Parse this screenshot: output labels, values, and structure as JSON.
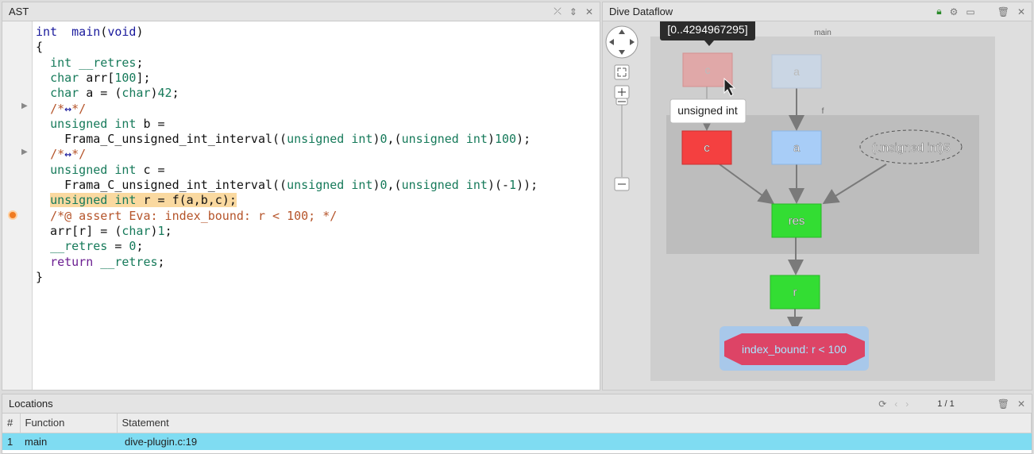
{
  "ast": {
    "title": "AST",
    "lines": [
      {
        "tokens": [
          [
            "kw",
            "int"
          ],
          [
            "",
            "  "
          ],
          [
            "kw",
            "main"
          ],
          [
            "",
            "("
          ],
          [
            "kw",
            "void"
          ],
          [
            "",
            ")"
          ]
        ]
      },
      {
        "tokens": [
          [
            "",
            "{"
          ]
        ]
      },
      {
        "tokens": [
          [
            "",
            "  "
          ],
          [
            "ty",
            "int"
          ],
          [
            "",
            " "
          ],
          [
            "ty",
            "__retres"
          ],
          [
            "",
            ";"
          ]
        ]
      },
      {
        "tokens": [
          [
            "",
            "  "
          ],
          [
            "ty",
            "char"
          ],
          [
            "",
            " arr["
          ],
          [
            "num",
            "100"
          ],
          [
            "",
            "];"
          ]
        ]
      },
      {
        "tokens": [
          [
            "",
            "  "
          ],
          [
            "ty",
            "char"
          ],
          [
            "",
            " a = ("
          ],
          [
            "ty",
            "char"
          ],
          [
            "",
            ")"
          ],
          [
            "num",
            "42"
          ],
          [
            "",
            ";"
          ]
        ]
      },
      {
        "tokens": [
          [
            "",
            "  "
          ],
          [
            "cm",
            "/*"
          ],
          [
            "kw",
            "↔"
          ],
          [
            "cm",
            "*/"
          ]
        ]
      },
      {
        "tokens": [
          [
            "",
            "  "
          ],
          [
            "ty",
            "unsigned int"
          ],
          [
            "",
            " b ="
          ]
        ]
      },
      {
        "tokens": [
          [
            "",
            "    Frama_C_unsigned_int_interval(("
          ],
          [
            "ty",
            "unsigned int"
          ],
          [
            "",
            ")"
          ],
          [
            "num",
            "0"
          ],
          [
            "",
            ",("
          ],
          [
            "ty",
            "unsigned int"
          ],
          [
            "",
            ")"
          ],
          [
            "num",
            "100"
          ],
          [
            "",
            ");"
          ]
        ]
      },
      {
        "tokens": [
          [
            "",
            "  "
          ],
          [
            "cm",
            "/*"
          ],
          [
            "kw",
            "↔"
          ],
          [
            "cm",
            "*/"
          ]
        ]
      },
      {
        "tokens": [
          [
            "",
            "  "
          ],
          [
            "ty",
            "unsigned int"
          ],
          [
            "",
            " c ="
          ]
        ]
      },
      {
        "tokens": [
          [
            "",
            "    Frama_C_unsigned_int_interval(("
          ],
          [
            "ty",
            "unsigned int"
          ],
          [
            "",
            ")"
          ],
          [
            "num",
            "0"
          ],
          [
            "",
            ",("
          ],
          [
            "ty",
            "unsigned int"
          ],
          [
            "",
            ")(-"
          ],
          [
            "num",
            "1"
          ],
          [
            "",
            "));"
          ]
        ]
      },
      {
        "tokens": [
          [
            "",
            "  "
          ],
          [
            "hl ty",
            "unsigned int"
          ],
          [
            "hl",
            " r = f(a,b,c);"
          ]
        ]
      },
      {
        "tokens": [
          [
            "",
            "  "
          ],
          [
            "cm",
            "/*@ assert Eva: index_bound: r < 100; */"
          ]
        ]
      },
      {
        "tokens": [
          [
            "",
            "  arr[r] = ("
          ],
          [
            "ty",
            "char"
          ],
          [
            "",
            ")"
          ],
          [
            "num",
            "1"
          ],
          [
            "",
            ";"
          ]
        ]
      },
      {
        "tokens": [
          [
            "",
            "  "
          ],
          [
            "ty",
            "__retres"
          ],
          [
            "",
            " = "
          ],
          [
            "num",
            "0"
          ],
          [
            "",
            ";"
          ]
        ]
      },
      {
        "tokens": [
          [
            "",
            "  "
          ],
          [
            "purple",
            "return"
          ],
          [
            "",
            " "
          ],
          [
            "ty",
            "__retres"
          ],
          [
            "",
            ";"
          ]
        ]
      },
      {
        "tokens": [
          [
            "",
            "}"
          ]
        ]
      }
    ]
  },
  "dive": {
    "title": "Dive Dataflow",
    "tooltip_range": "[0..4294967295]",
    "tooltip_type": "unsigned int",
    "cluster_main": "main",
    "cluster_f": "f",
    "nodes": {
      "c_ghost": "c",
      "a_ghost": "a",
      "c": "c",
      "a": "a",
      "cast": "(unsigned int)5",
      "res": "res",
      "r": "r",
      "alarm": "index_bound: r < 100"
    },
    "colors": {
      "red": "#f44040",
      "blue": "#a8cdf7",
      "green": "#33dd33",
      "alarm": "#dd4466"
    }
  },
  "locations": {
    "title": "Locations",
    "pager": "1 / 1",
    "columns": [
      "#",
      "Function",
      "Statement"
    ],
    "rows": [
      [
        "1",
        "main",
        "dive-plugin.c:19"
      ]
    ]
  }
}
